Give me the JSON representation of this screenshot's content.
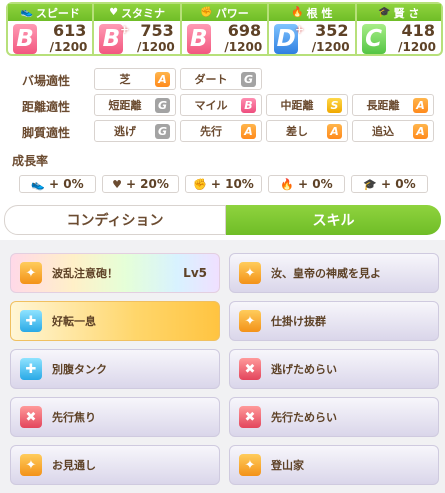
{
  "stats": [
    {
      "name": "スピード",
      "icon": "shoe-icon",
      "grade": "B",
      "plus": "",
      "value": "613",
      "max": "/1200"
    },
    {
      "name": "スタミナ",
      "icon": "heart-icon",
      "grade": "B",
      "plus": "+",
      "value": "753",
      "max": "/1200"
    },
    {
      "name": "パワー",
      "icon": "muscle-icon",
      "grade": "B",
      "plus": "",
      "value": "698",
      "max": "/1200"
    },
    {
      "name": "根 性",
      "icon": "flame-icon",
      "grade": "D",
      "plus": "+",
      "value": "352",
      "max": "/1200"
    },
    {
      "name": "賢 さ",
      "icon": "grad-cap-icon",
      "grade": "C",
      "plus": "",
      "value": "418",
      "max": "/1200"
    }
  ],
  "aptitude": {
    "track_label": "バ場適性",
    "distance_label": "距離適性",
    "style_label": "脚質適性",
    "track": [
      {
        "name": "芝",
        "rank": "A"
      },
      {
        "name": "ダート",
        "rank": "G"
      }
    ],
    "distance": [
      {
        "name": "短距離",
        "rank": "G"
      },
      {
        "name": "マイル",
        "rank": "B"
      },
      {
        "name": "中距離",
        "rank": "S"
      },
      {
        "name": "長距離",
        "rank": "A"
      }
    ],
    "style": [
      {
        "name": "逃げ",
        "rank": "G"
      },
      {
        "name": "先行",
        "rank": "A"
      },
      {
        "name": "差し",
        "rank": "A"
      },
      {
        "name": "追込",
        "rank": "A"
      }
    ]
  },
  "growth": {
    "title": "成長率",
    "items": [
      {
        "icon": "shoe-icon",
        "value": "+ 0%"
      },
      {
        "icon": "heart-icon",
        "value": "+ 20%"
      },
      {
        "icon": "muscle-icon",
        "value": "+ 10%"
      },
      {
        "icon": "flame-icon",
        "value": "+ 0%"
      },
      {
        "icon": "grad-cap-icon",
        "value": "+ 0%"
      }
    ]
  },
  "tabs": {
    "condition": "コンディション",
    "skill": "スキル"
  },
  "skills": [
    {
      "name": "波乱注意砲！",
      "lv": "Lv5",
      "style": "rainbow",
      "icon_color": "orange"
    },
    {
      "name": "汝、皇帝の神威を見よ",
      "lv": "",
      "style": "normal",
      "icon_color": "orange"
    },
    {
      "name": "好転一息",
      "lv": "",
      "style": "gold",
      "icon_color": "blue"
    },
    {
      "name": "仕掛け抜群",
      "lv": "",
      "style": "normal",
      "icon_color": "orange"
    },
    {
      "name": "別腹タンク",
      "lv": "",
      "style": "normal",
      "icon_color": "blue"
    },
    {
      "name": "逃げためらい",
      "lv": "",
      "style": "normal",
      "icon_color": "red"
    },
    {
      "name": "先行焦り",
      "lv": "",
      "style": "normal",
      "icon_color": "red"
    },
    {
      "name": "先行ためらい",
      "lv": "",
      "style": "normal",
      "icon_color": "red"
    },
    {
      "name": "お見通し",
      "lv": "",
      "style": "normal",
      "icon_color": "orange"
    },
    {
      "name": "登山家",
      "lv": "",
      "style": "normal",
      "icon_color": "orange"
    }
  ],
  "colors": {
    "accent": "#79c52e",
    "rank_a": "#ff9a26",
    "rank_b": "#f0628a",
    "rank_s": "#f2b300",
    "rank_g": "#a3a3a3"
  }
}
